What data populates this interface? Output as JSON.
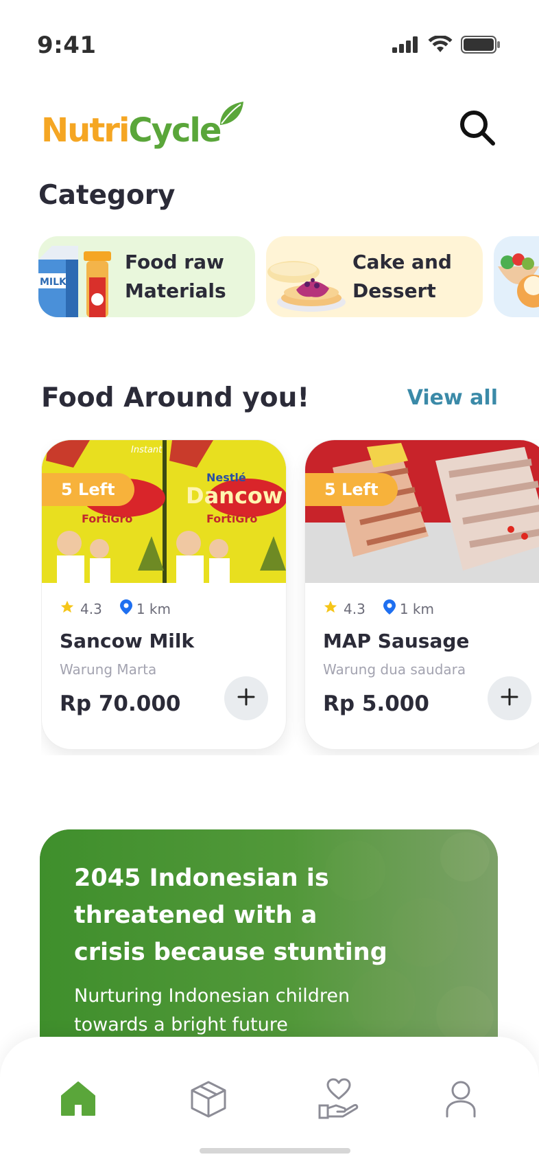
{
  "status": {
    "time": "9:41"
  },
  "header": {
    "logo_part1": "Nutri",
    "logo_part2": "Cycle"
  },
  "category": {
    "title": "Category",
    "items": [
      {
        "label_line1": "Food raw",
        "label_line2": "Materials"
      },
      {
        "label_line1": "Cake and",
        "label_line2": "Dessert"
      },
      {
        "label_line1": "",
        "label_line2": ""
      }
    ]
  },
  "food": {
    "title": "Food Around you!",
    "view_all": "View all",
    "items": [
      {
        "badge": "5 Left",
        "rating": "4.3",
        "distance": "1 km",
        "name": "Sancow Milk",
        "seller": "Warung Marta",
        "price": "Rp 70.000"
      },
      {
        "badge": "5 Left",
        "rating": "4.3",
        "distance": "1 km",
        "name": "MAP Sausage",
        "seller": "Warung dua saudara",
        "price": "Rp 5.000"
      }
    ]
  },
  "banner": {
    "title": "2045 Indonesian is threatened with a crisis because stunting",
    "subtitle": "Nurturing Indonesian children towards a bright future"
  },
  "nav": {
    "items": [
      {
        "icon": "home-icon",
        "active": true
      },
      {
        "icon": "box-icon",
        "active": false
      },
      {
        "icon": "donate-icon",
        "active": false
      },
      {
        "icon": "profile-icon",
        "active": false
      }
    ]
  },
  "colors": {
    "brand_orange": "#f5a623",
    "brand_green": "#5aa63a",
    "link_blue": "#3b8aa8",
    "badge_orange": "#f7b23b",
    "banner_green": "#3f8f2c"
  }
}
